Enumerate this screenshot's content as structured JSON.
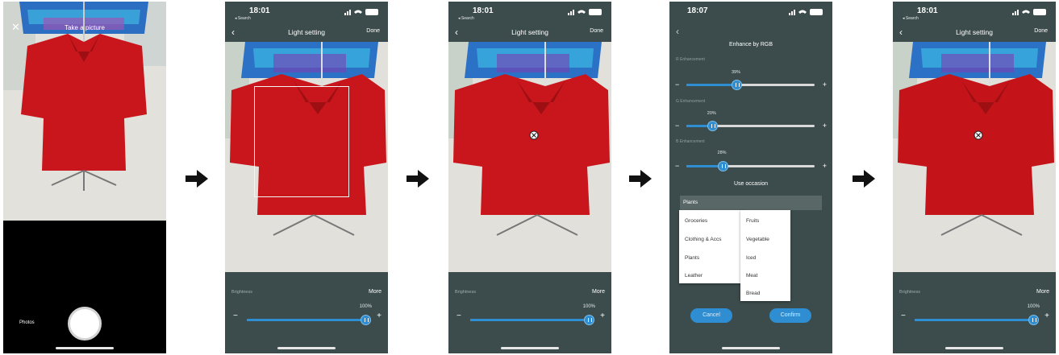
{
  "status": {
    "time_a": "18:01",
    "time_b": "18:07",
    "back_app": "◂ Search",
    "battery": "100"
  },
  "camera": {
    "title": "Take a picture",
    "photos_label": "Photos"
  },
  "light_setting": {
    "title": "Light setting",
    "done_label": "Done",
    "brightness_label": "Brightness",
    "more_label": "More",
    "brightness_value": "100%",
    "brightness_fraction": 1.0,
    "minus": "−",
    "plus": "+"
  },
  "rgb": {
    "title": "Enhance by RGB",
    "rows": [
      {
        "label": "R Enhancement",
        "value": "39%",
        "fraction": 0.39
      },
      {
        "label": "G Enhancement",
        "value": "20%",
        "fraction": 0.2
      },
      {
        "label": "B Enhancement",
        "value": "28%",
        "fraction": 0.28
      }
    ],
    "occasion_title": "Use occasion",
    "occasion_selected": "Plants",
    "categories": [
      "Groceries",
      "Clothing & Accs",
      "Plants",
      "Leather"
    ],
    "subcategories": [
      "Fruits",
      "Vegetable",
      "Iced",
      "Meat",
      "Bread"
    ],
    "cancel_label": "Cancel",
    "confirm_label": "Confirm"
  },
  "colors": {
    "panel": "#3c4b4b",
    "accent": "#2f8dd1",
    "shirt": "#c8161c"
  }
}
